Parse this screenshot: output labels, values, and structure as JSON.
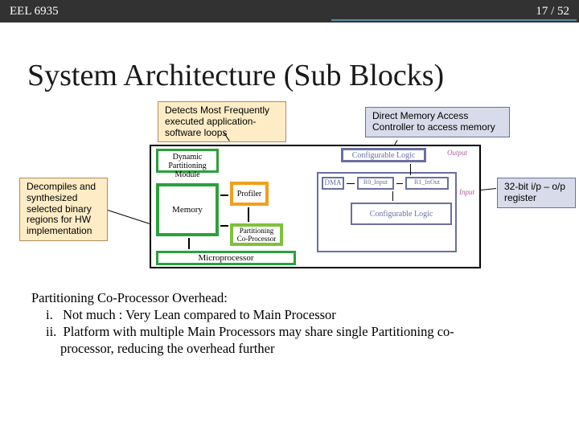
{
  "header": {
    "left": "EEL 6935",
    "right": "17 / 52"
  },
  "title": "System Architecture (Sub Blocks)",
  "callouts": {
    "c1": "Detects Most Frequently executed application-software loops",
    "c2": "Direct Memory Access Controller to access memory",
    "c3": "Decompiles and synthesized selected binary regions for HW implementation",
    "c4": "32-bit i/p – o/p register"
  },
  "diagram": {
    "dyn": "Dynamic Partitioning Module",
    "memory": "Memory",
    "profiler": "Profiler",
    "part": "Partitioning Co-Processor",
    "micro": "Microprocessor",
    "conf_top": "Configurable Logic",
    "dma": "DMA",
    "r0": "R0_Input",
    "r1": "R1_InOut",
    "conf_mid": "Configurable Logic",
    "output_lbl": "Output",
    "input_lbl": "Input"
  },
  "body": {
    "head": "Partitioning Co-Processor Overhead:",
    "i1_pre": "i.",
    "i1": "Not much : Very Lean compared to Main Processor",
    "i2_pre": "ii.",
    "i2a": "Platform with multiple Main Processors may share single Partitioning co-",
    "i2b": "processor, reducing the overhead further"
  }
}
